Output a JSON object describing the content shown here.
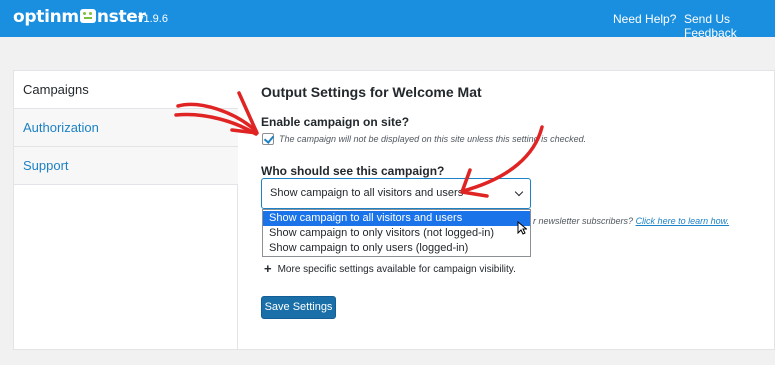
{
  "header": {
    "logo_text_left": "optinm",
    "logo_text_right": "nster",
    "version": "v1.9.6",
    "need_help": "Need Help?",
    "send_feedback": "Send Us Feedback"
  },
  "sidebar": {
    "items": [
      {
        "label": "Campaigns",
        "active": true
      },
      {
        "label": "Authorization",
        "active": false
      },
      {
        "label": "Support",
        "active": false
      }
    ]
  },
  "main": {
    "heading": "Output Settings for Welcome Mat",
    "enable_label": "Enable campaign on site?",
    "enable_checked": true,
    "enable_help": "The campaign will not be displayed on this site unless this setting is checked.",
    "who_label": "Who should see this campaign?",
    "who_selected": "Show campaign to all visitors and users",
    "who_options": [
      "Show campaign to all visitors and users",
      "Show campaign to only visitors (not logged-in)",
      "Show campaign to only users (logged-in)"
    ],
    "newsletter_partial": "r newsletter subscribers?",
    "newsletter_link": "Click here to learn how.",
    "more_settings": "More specific settings available for campaign visibility.",
    "save_label": "Save Settings"
  },
  "colors": {
    "header_bg": "#1a8fe0",
    "link": "#1d82c5",
    "selected_option": "#1a73e8",
    "save_button": "#1a6fa8",
    "annotation_arrow": "#e02424"
  }
}
